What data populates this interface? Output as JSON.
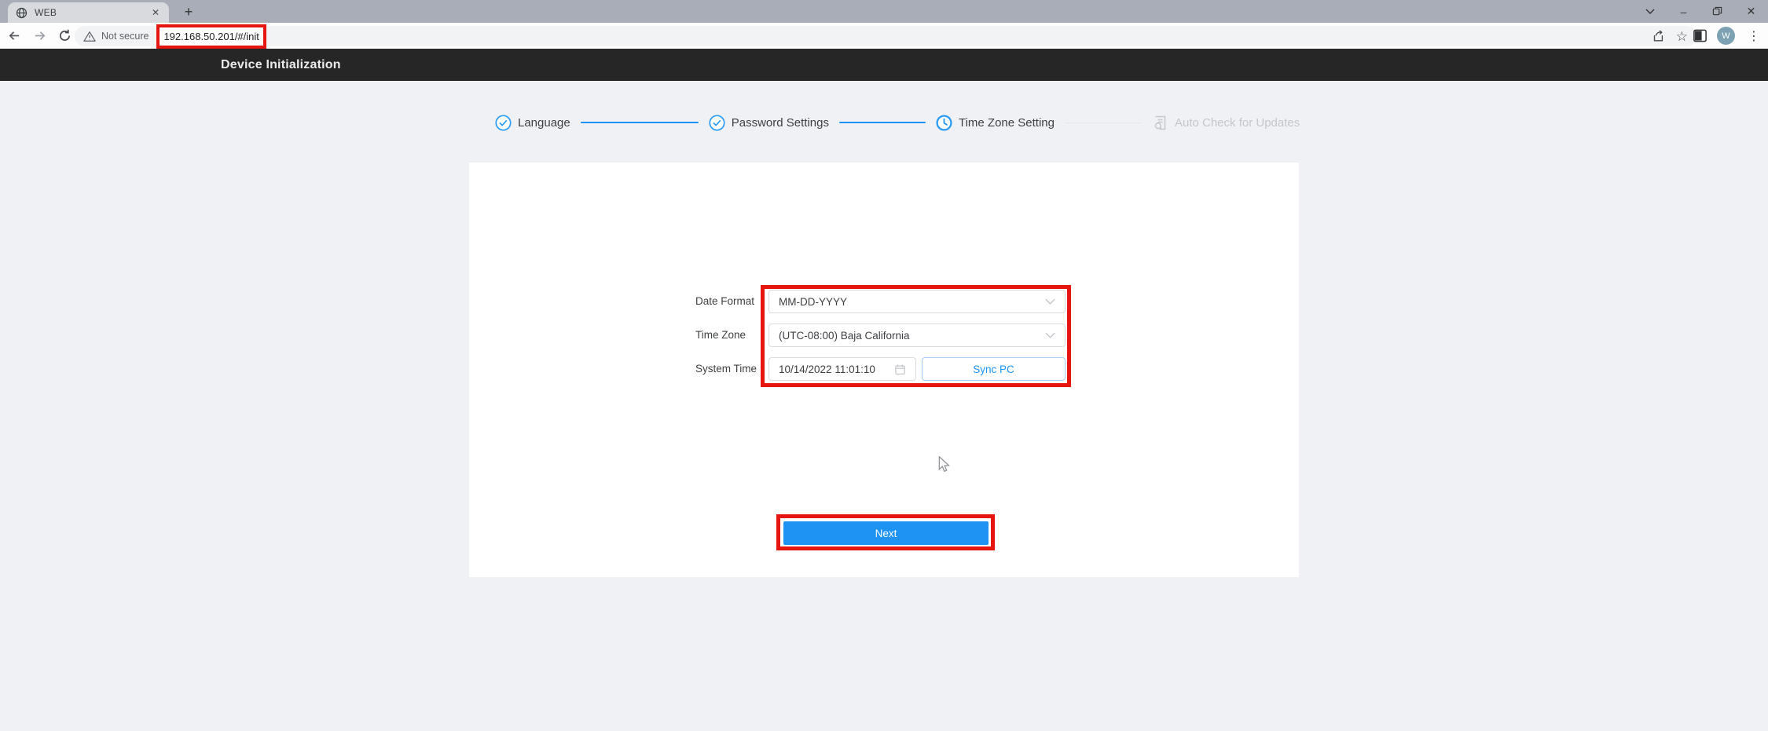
{
  "browser": {
    "tab_title": "WEB",
    "not_secure_label": "Not secure",
    "url": "192.168.50.201/#/init",
    "avatar_initial": "W",
    "glyphs": {
      "new_tab": "+",
      "tab_close": "✕",
      "minimize": "–",
      "star": "☆",
      "more": "⋮"
    }
  },
  "header": {
    "title": "Device Initialization"
  },
  "wizard": {
    "steps": [
      {
        "label": "Language",
        "state": "done"
      },
      {
        "label": "Password Settings",
        "state": "done"
      },
      {
        "label": "Time Zone Setting",
        "state": "current"
      },
      {
        "label": "Auto Check for Updates",
        "state": "pending"
      }
    ]
  },
  "form": {
    "date_format_label": "Date Format",
    "date_format_value": "MM-DD-YYYY",
    "time_zone_label": "Time Zone",
    "time_zone_value": "(UTC-08:00) Baja California",
    "system_time_label": "System Time",
    "system_time_value": "10/14/2022 11:01:10",
    "sync_pc_label": "Sync PC"
  },
  "actions": {
    "next_label": "Next"
  },
  "colors": {
    "accent_blue": "#1e93f4",
    "annotation_red": "#e61510",
    "header_bg": "#262626",
    "page_bg": "#eff1f4"
  }
}
